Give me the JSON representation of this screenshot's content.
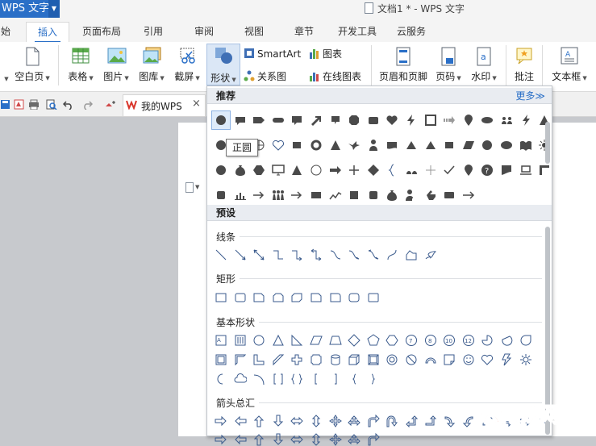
{
  "app": {
    "menu_label": "WPS 文字",
    "window_title": "文档1 * - WPS 文字"
  },
  "tabs": [
    {
      "label": "始"
    },
    {
      "label": "插入"
    },
    {
      "label": "页面布局"
    },
    {
      "label": "引用"
    },
    {
      "label": "审阅"
    },
    {
      "label": "视图"
    },
    {
      "label": "章节"
    },
    {
      "label": "开发工具"
    },
    {
      "label": "云服务"
    }
  ],
  "ribbon": {
    "blank_page": "空白页",
    "table": "表格",
    "picture": "图片",
    "gallery": "图库",
    "screenshot": "截屏",
    "shape": "形状",
    "smartart": "SmartArt",
    "chart": "图表",
    "relation": "关系图",
    "online_chart": "在线图表",
    "header_footer": "页眉和页脚",
    "page_number": "页码",
    "watermark": "水印",
    "comment": "批注",
    "textbox": "文本框"
  },
  "quickbar": {
    "doc_tab": "我的WPS",
    "close": "×"
  },
  "shapes_panel": {
    "recommended_title": "推荐",
    "more": "更多≫",
    "preset_title": "预设",
    "categories": {
      "lines": "线条",
      "rectangles": "矩形",
      "basic": "基本形状",
      "arrows": "箭头总汇"
    },
    "tooltip": "正圆"
  },
  "watermark_text": "云南龙网",
  "colors": {
    "accent": "#2a6fc7",
    "shape_fill": "#4a4a4a",
    "outline": "#3a5a8c"
  }
}
